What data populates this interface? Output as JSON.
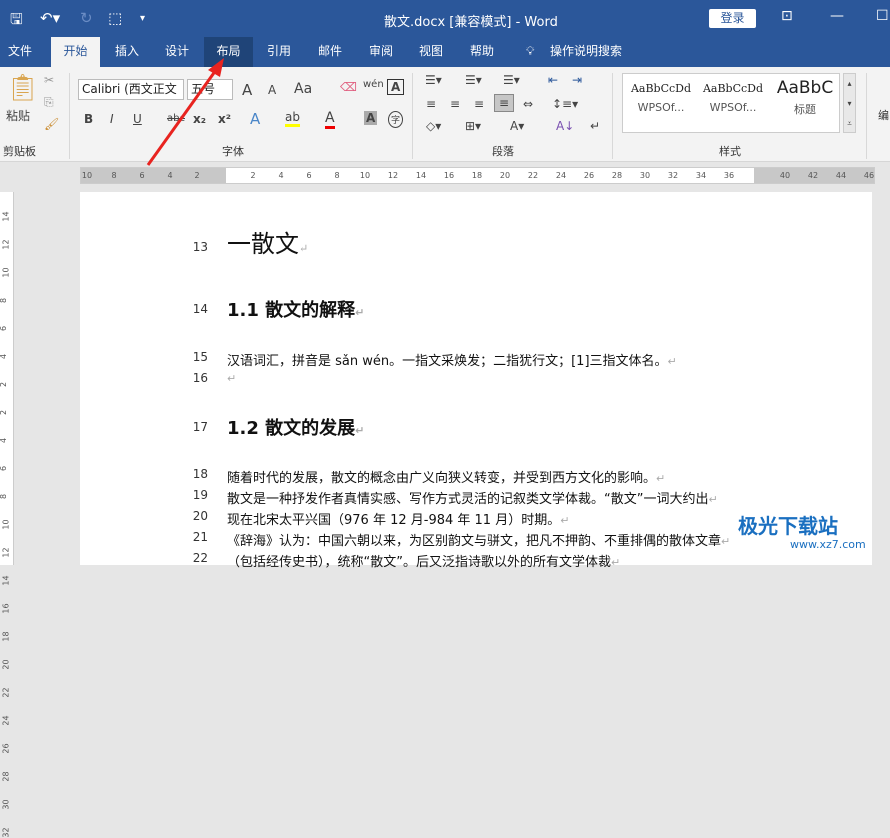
{
  "titlebar": {
    "title": "散文.docx [兼容模式] - Word",
    "login": "登录"
  },
  "tabs": [
    "文件",
    "开始",
    "插入",
    "设计",
    "布局",
    "引用",
    "邮件",
    "审阅",
    "视图",
    "帮助"
  ],
  "tell_me": "操作说明搜索",
  "ribbon": {
    "clipboard": {
      "paste": "粘贴",
      "label": "剪贴板"
    },
    "font": {
      "name": "Calibri (西文正文",
      "size": "五号",
      "label": "字体",
      "grow": "A",
      "shrink": "A",
      "case": "Aa",
      "phonetic": "wén",
      "bold": "B",
      "italic": "I",
      "underline": "U",
      "strike": "abc",
      "sub": "x₂",
      "sup": "x²",
      "enclose": "字"
    },
    "paragraph": {
      "label": "段落"
    },
    "styles": {
      "label": "样式",
      "items": [
        {
          "preview": "AaBbCcDd",
          "name": "WPSOf..."
        },
        {
          "preview": "AaBbCcDd",
          "name": "WPSOf..."
        },
        {
          "preview": "AaBbC",
          "name": "标题"
        }
      ]
    },
    "edit": {
      "label": "编"
    }
  },
  "ruler": {
    "ticks": [
      "10",
      "8",
      "6",
      "4",
      "2",
      "2",
      "4",
      "6",
      "8",
      "10",
      "12",
      "14",
      "16",
      "18",
      "20",
      "22",
      "24",
      "26",
      "28",
      "30",
      "32",
      "34",
      "36",
      "40",
      "42",
      "44",
      "46"
    ]
  },
  "vruler": [
    "14",
    "12",
    "10",
    "8",
    "6",
    "4",
    "2",
    "2",
    "4",
    "6",
    "8",
    "10",
    "12",
    "14",
    "16",
    "18",
    "20",
    "22",
    "24",
    "26",
    "28",
    "30",
    "32"
  ],
  "document": {
    "lines": [
      {
        "n": "13",
        "text": "一散文",
        "cls": "h1"
      },
      {
        "n": "14",
        "text": "1.1 散文的解释",
        "cls": "h2"
      },
      {
        "n": "15",
        "text": "汉语词汇，拼音是 sǎn wén。一指文采焕发；二指犹行文；[1]三指文体名。",
        "cls": ""
      },
      {
        "n": "16",
        "text": "",
        "cls": ""
      },
      {
        "n": "17",
        "text": "1.2 散文的发展",
        "cls": "h2"
      },
      {
        "n": "18",
        "text": "随着时代的发展，散文的概念由广义向狭义转变，并受到西方文化的影响。",
        "cls": ""
      },
      {
        "n": "19",
        "text": "散文是一种抒发作者真情实感、写作方式灵活的记叙类文学体裁。“散文”一词大约出",
        "cls": ""
      },
      {
        "n": "20",
        "text": "现在北宋太平兴国（976 年 12 月-984 年 11 月）时期。",
        "cls": ""
      },
      {
        "n": "21",
        "text": "《辞海》认为：中国六朝以来，为区别韵文与骈文，把凡不押韵、不重排偶的散体文章",
        "cls": ""
      },
      {
        "n": "22",
        "text": "（包括经传史书），统称“散文”。后又泛指诗歌以外的所有文学体裁",
        "cls": ""
      }
    ]
  },
  "watermark": {
    "name": "极光下载站",
    "url": "www.xz7.com"
  },
  "colors": {
    "brand": "#2b579a",
    "arrow": "#e8231f"
  }
}
